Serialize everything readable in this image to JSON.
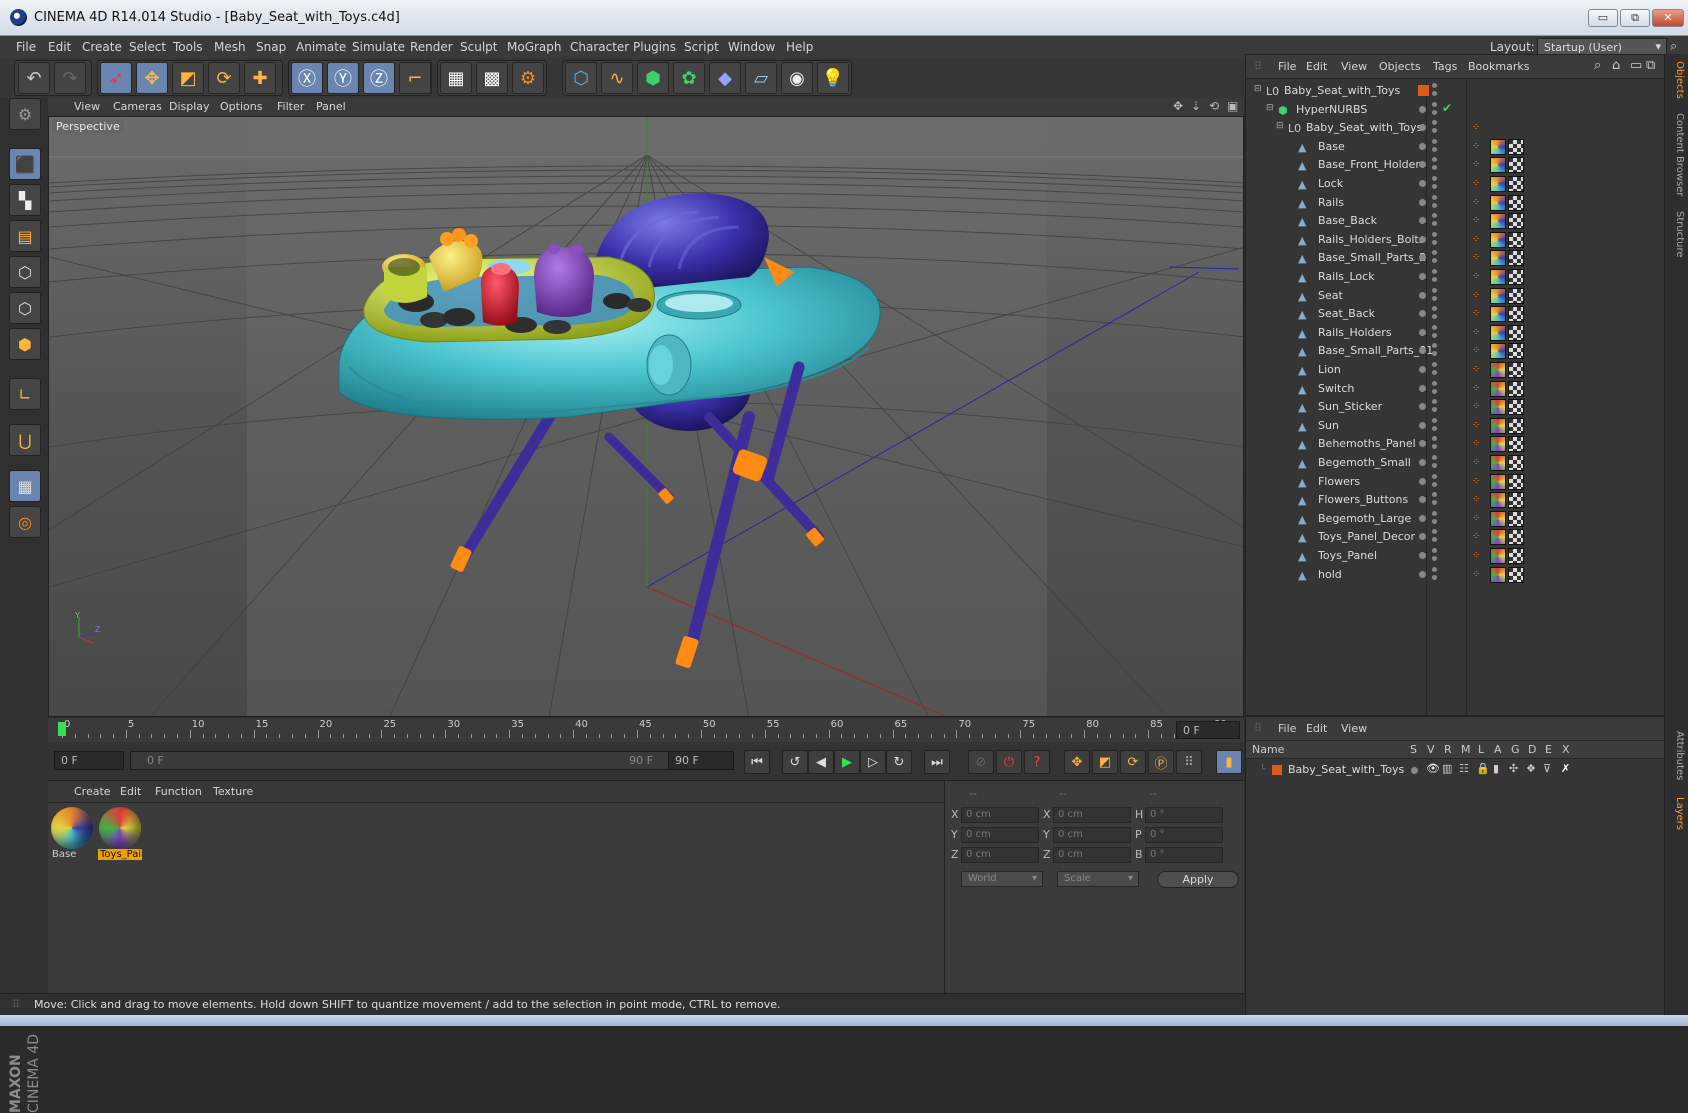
{
  "window": {
    "title": "CINEMA 4D R14.014 Studio - [Baby_Seat_with_Toys.c4d]",
    "minimize": "▭",
    "restore": "⧉",
    "close": "✕"
  },
  "menubar": {
    "items": [
      "File",
      "Edit",
      "Create",
      "Select",
      "Tools",
      "Mesh",
      "Snap",
      "Animate",
      "Simulate",
      "Render",
      "Sculpt",
      "MoGraph",
      "Character",
      "Plugins",
      "Script",
      "Window",
      "Help"
    ],
    "layout_label": "Layout:",
    "layout_value": "Startup (User)"
  },
  "viewport": {
    "menu": [
      "View",
      "Cameras",
      "Display",
      "Options",
      "Filter",
      "Panel"
    ],
    "label": "Perspective",
    "axis_y": "Y",
    "axis_z": "Z"
  },
  "timeline": {
    "ticks": [
      "0",
      "5",
      "10",
      "15",
      "20",
      "25",
      "30",
      "35",
      "40",
      "45",
      "50",
      "55",
      "60",
      "65",
      "70",
      "75",
      "80",
      "85",
      "90"
    ],
    "current_frame": "0 F",
    "start_frame": "0 F",
    "range_start": "0 F",
    "range_end": "90 F",
    "end_frame": "90 F"
  },
  "materials": {
    "menu": [
      "Create",
      "Edit",
      "Function",
      "Texture"
    ],
    "items": [
      {
        "name": "Base"
      },
      {
        "name": "Toys_Pai"
      }
    ]
  },
  "coords": {
    "header": [
      "--",
      "--",
      "--"
    ],
    "rows": [
      {
        "a": "X",
        "a_val": "0 cm",
        "b": "X",
        "b_val": "0 cm",
        "c": "H",
        "c_val": "0 °"
      },
      {
        "a": "Y",
        "a_val": "0 cm",
        "b": "Y",
        "b_val": "0 cm",
        "c": "P",
        "c_val": "0 °"
      },
      {
        "a": "Z",
        "a_val": "0 cm",
        "b": "Z",
        "b_val": "0 cm",
        "c": "B",
        "c_val": "0 °"
      }
    ],
    "space": "World",
    "mode": "Scale",
    "apply": "Apply"
  },
  "status": "Move: Click and drag to move elements. Hold down SHIFT to quantize movement / add to the selection in point mode, CTRL to remove.",
  "objects": {
    "menu": [
      "File",
      "Edit",
      "View",
      "Objects",
      "Tags",
      "Bookmarks"
    ],
    "tree": [
      {
        "name": "Baby_Seat_with_Toys",
        "level": 0,
        "kind": "null"
      },
      {
        "name": "HyperNURBS",
        "level": 1,
        "kind": "nurbs"
      },
      {
        "name": "Baby_Seat_with_Toys",
        "level": 2,
        "kind": "null"
      },
      {
        "name": "Base",
        "level": 3,
        "kind": "poly"
      },
      {
        "name": "Base_Front_Holder",
        "level": 3,
        "kind": "poly"
      },
      {
        "name": "Lock",
        "level": 3,
        "kind": "poly"
      },
      {
        "name": "Rails",
        "level": 3,
        "kind": "poly"
      },
      {
        "name": "Base_Back",
        "level": 3,
        "kind": "poly"
      },
      {
        "name": "Rails_Holders_Bolts",
        "level": 3,
        "kind": "poly"
      },
      {
        "name": "Base_Small_Parts_2",
        "level": 3,
        "kind": "poly"
      },
      {
        "name": "Rails_Lock",
        "level": 3,
        "kind": "poly"
      },
      {
        "name": "Seat",
        "level": 3,
        "kind": "poly"
      },
      {
        "name": "Seat_Back",
        "level": 3,
        "kind": "poly"
      },
      {
        "name": "Rails_Holders",
        "level": 3,
        "kind": "poly"
      },
      {
        "name": "Base_Small_Parts_01",
        "level": 3,
        "kind": "poly"
      },
      {
        "name": "Lion",
        "level": 3,
        "kind": "poly"
      },
      {
        "name": "Switch",
        "level": 3,
        "kind": "poly"
      },
      {
        "name": "Sun_Sticker",
        "level": 3,
        "kind": "poly"
      },
      {
        "name": "Sun",
        "level": 3,
        "kind": "poly"
      },
      {
        "name": "Behemoths_Panel",
        "level": 3,
        "kind": "poly"
      },
      {
        "name": "Begemoth_Small",
        "level": 3,
        "kind": "poly"
      },
      {
        "name": "Flowers",
        "level": 3,
        "kind": "poly"
      },
      {
        "name": "Flowers_Buttons",
        "level": 3,
        "kind": "poly"
      },
      {
        "name": "Begemoth_Large",
        "level": 3,
        "kind": "poly"
      },
      {
        "name": "Toys_Panel_Decor",
        "level": 3,
        "kind": "poly"
      },
      {
        "name": "Toys_Panel",
        "level": 3,
        "kind": "poly"
      },
      {
        "name": "hold",
        "level": 3,
        "kind": "poly"
      }
    ]
  },
  "layers": {
    "menu": [
      "File",
      "Edit",
      "View"
    ],
    "columns": [
      "Name",
      "S",
      "V",
      "R",
      "M",
      "L",
      "A",
      "G",
      "D",
      "E",
      "X"
    ],
    "rows": [
      {
        "name": "Baby_Seat_with_Toys",
        "color": "#e05a1a"
      }
    ]
  },
  "side_tabs": [
    "Objects",
    "Content Browser",
    "Structure",
    "Attributes",
    "Layers"
  ],
  "logo": {
    "line1": "MAXON",
    "line2": "CINEMA 4D"
  },
  "colors": {
    "accent": "#6a86b0",
    "orange": "#ff8a1e",
    "layer": "#e05a1a"
  }
}
